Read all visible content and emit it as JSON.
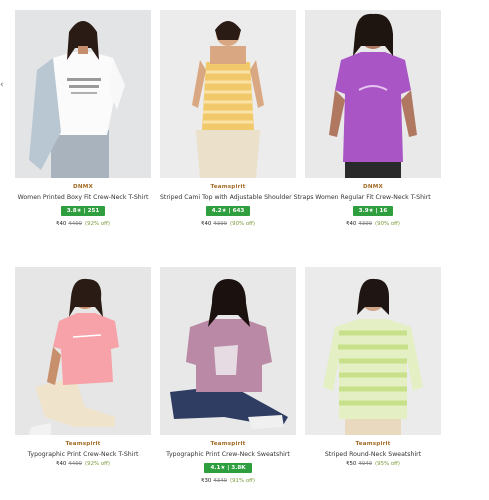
{
  "products": [
    {
      "brand": "DNMX",
      "name": "Women Printed Boxy Fit Crew-Neck T-Shirt",
      "rating": "3.8★ | 251",
      "price": "₹40",
      "mrp": "₹499",
      "discount": "(92% off)",
      "bg": "#e3e4e6",
      "garment": "#fbfbfb",
      "accent": "#a8b8c8"
    },
    {
      "brand": "Teamspirit",
      "name": "Striped Cami Top with Adjustable Shoulder Straps",
      "rating": "4.2★ | 643",
      "price": "₹40",
      "mrp": "₹399",
      "discount": "(90% off)",
      "bg": "#ececec",
      "garment": "#f1c96a",
      "accent": "#ebe0c9"
    },
    {
      "brand": "DNMX",
      "name": "Women Regular Fit Crew-Neck T-Shirt",
      "rating": "3.9★ | 16",
      "price": "₹40",
      "mrp": "₹399",
      "discount": "(90% off)",
      "bg": "#e9e9e9",
      "garment": "#a955c6",
      "accent": "#2a2a2a"
    },
    {
      "brand": "Teamspirit",
      "name": "Typographic Print Crew-Neck T-Shirt",
      "rating": "",
      "price": "₹40",
      "mrp": "₹499",
      "discount": "(92% off)",
      "bg": "#e6e6e6",
      "garment": "#f7a1a8",
      "accent": "#efe3cc"
    },
    {
      "brand": "Teamspirit",
      "name": "Typographic Print Crew-Neck Sweatshirt",
      "rating": "4.1★ | 3.8K",
      "price": "₹30",
      "mrp": "₹349",
      "discount": "(91% off)",
      "bg": "#e8e8e8",
      "garment": "#b989a6",
      "accent": "#2f3d63"
    },
    {
      "brand": "Teamspirit",
      "name": "Striped Round-Neck Sweatshirt",
      "rating": "",
      "price": "₹50",
      "mrp": "₹949",
      "discount": "(95% off)",
      "bg": "#ebebeb",
      "garment": "#e4efc4",
      "accent": "#e8d9bf"
    }
  ]
}
